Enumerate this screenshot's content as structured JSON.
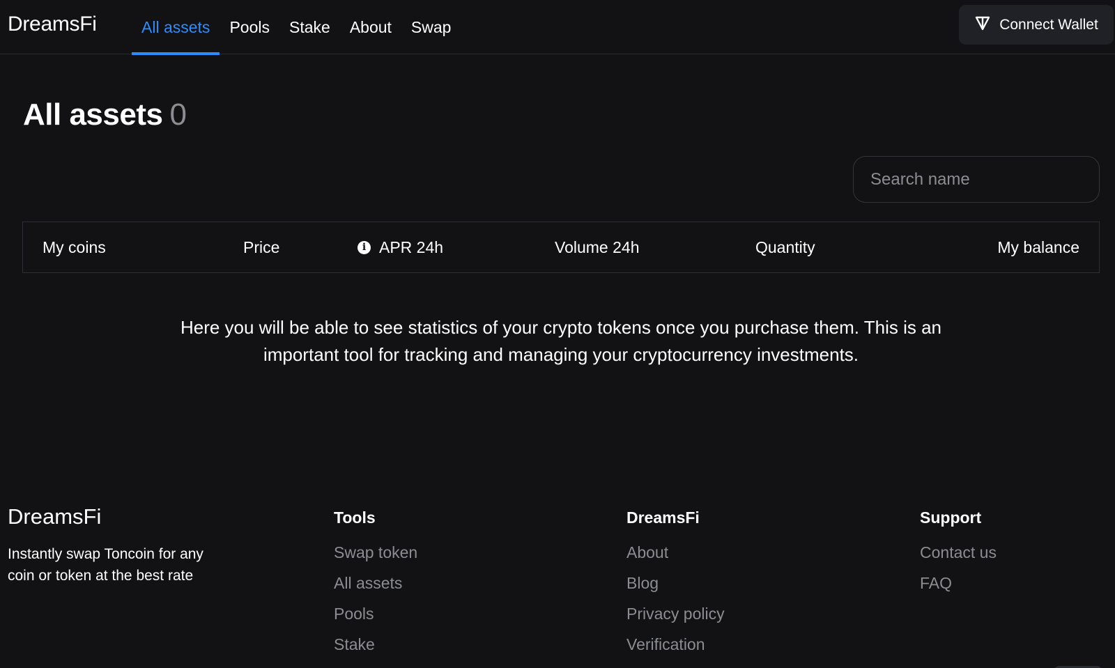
{
  "header": {
    "logo": "DreamsFi",
    "nav": [
      {
        "label": "All assets",
        "active": true
      },
      {
        "label": "Pools",
        "active": false
      },
      {
        "label": "Stake",
        "active": false
      },
      {
        "label": "About",
        "active": false
      },
      {
        "label": "Swap",
        "active": false
      }
    ],
    "connect_wallet": {
      "label": "Connect Wallet",
      "icon": "ton-logo-icon"
    }
  },
  "main": {
    "title": "All assets",
    "count": "0",
    "search": {
      "placeholder": "Search name",
      "value": ""
    },
    "table": {
      "columns": [
        "My coins",
        "Price",
        "APR 24h",
        "Volume 24h",
        "Quantity",
        "My balance"
      ],
      "apr_icon": "info-icon"
    },
    "empty_message": "Here you will be able to see statistics of your crypto tokens once you purchase them. This is an important tool for tracking and managing your cryptocurrency investments."
  },
  "footer": {
    "logo": "DreamsFi",
    "tagline": "Instantly swap Toncoin for any coin or token at the best rate",
    "columns": [
      {
        "title": "Tools",
        "links": [
          "Swap token",
          "All assets",
          "Pools",
          "Stake"
        ]
      },
      {
        "title": "DreamsFi",
        "links": [
          "About",
          "Blog",
          "Privacy policy",
          "Verification"
        ]
      },
      {
        "title": "Support",
        "links": [
          "Contact us",
          "FAQ"
        ]
      }
    ]
  },
  "colors": {
    "background": "#121215",
    "accent": "#2c8dff",
    "muted_text": "#8c8d93",
    "button_bg": "#202126"
  }
}
